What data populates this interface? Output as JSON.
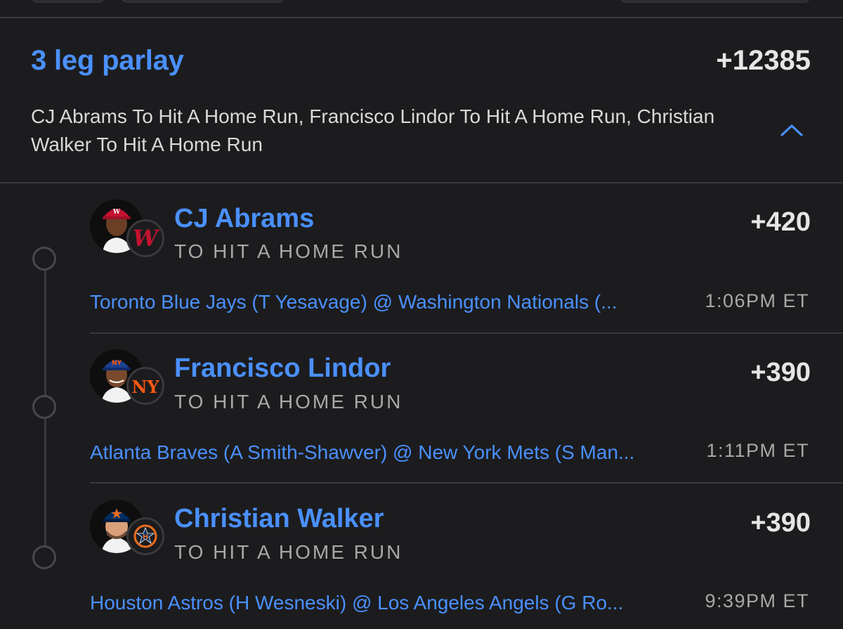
{
  "parlay": {
    "title": "3 leg parlay",
    "odds": "+12385",
    "summary": "CJ Abrams To Hit A Home Run, Francisco Lindor To Hit A Home Run, Christian Walker To Hit A Home Run",
    "collapse_icon": "chevron-up-icon"
  },
  "legs": [
    {
      "player": "CJ Abrams",
      "market": "TO HIT A HOME RUN",
      "odds": "+420",
      "matchup": "Toronto Blue Jays (T Yesavage) @ Washington Nationals (...",
      "time": "1:06PM ET",
      "team_icon": "nationals-logo-icon",
      "team_color": "#c41230"
    },
    {
      "player": "Francisco Lindor",
      "market": "TO HIT A HOME RUN",
      "odds": "+390",
      "matchup": "Atlanta Braves (A Smith-Shawver) @ New York Mets (S Man...",
      "time": "1:11PM ET",
      "team_icon": "mets-logo-icon",
      "team_color": "#ff5910"
    },
    {
      "player": "Christian Walker",
      "market": "TO HIT A HOME RUN",
      "odds": "+390",
      "matchup": "Houston Astros (H Wesneski) @ Los Angeles Angels (G Ro...",
      "time": "9:39PM ET",
      "team_icon": "astros-logo-icon",
      "team_color": "#eb6e1f"
    }
  ],
  "colors": {
    "accent": "#4a90ff",
    "background": "#1c1c1e",
    "divider": "#3a3a3c"
  }
}
